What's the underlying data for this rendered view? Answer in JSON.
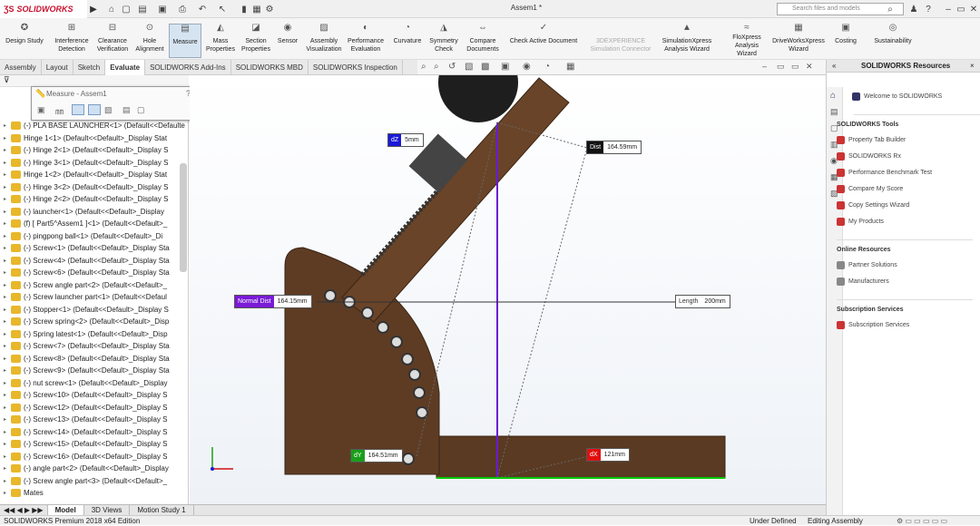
{
  "app": {
    "brand": "SOLIDWORKS",
    "doc_title": "Assem1 *",
    "search_placeholder": "Search files and models"
  },
  "commands": [
    {
      "l1": "Design Study",
      "l2": "",
      "icon": "design-study-icon"
    },
    {
      "l1": "Interference",
      "l2": "Detection",
      "icon": "interference-icon"
    },
    {
      "l1": "Clearance",
      "l2": "Verification",
      "icon": "clearance-icon"
    },
    {
      "l1": "Hole",
      "l2": "Alignment",
      "icon": "hole-icon"
    },
    {
      "l1": "Measure",
      "l2": "",
      "icon": "measure-icon"
    },
    {
      "l1": "Mass",
      "l2": "Properties",
      "icon": "mass-icon"
    },
    {
      "l1": "Section",
      "l2": "Properties",
      "icon": "section-icon"
    },
    {
      "l1": "Sensor",
      "l2": "",
      "icon": "sensor-icon"
    },
    {
      "l1": "Assembly",
      "l2": "Visualization",
      "icon": "assembly-vis-icon"
    },
    {
      "l1": "Performance",
      "l2": "Evaluation",
      "icon": "performance-icon"
    },
    {
      "l1": "Curvature",
      "l2": "",
      "icon": "curvature-icon"
    },
    {
      "l1": "Symmetry",
      "l2": "Check",
      "icon": "symmetry-icon"
    },
    {
      "l1": "Compare",
      "l2": "Documents",
      "icon": "compare-icon"
    },
    {
      "l1": "Check Active Document",
      "l2": "",
      "icon": "check-icon"
    },
    {
      "l1": "3DEXPERIENCE",
      "l2": "Simulation Connector",
      "icon": ""
    },
    {
      "l1": "SimulationXpress",
      "l2": "Analysis Wizard",
      "icon": "simxpress-icon"
    },
    {
      "l1": "FloXpress",
      "l2": "Analysis Wizard",
      "icon": "floxpress-icon"
    },
    {
      "l1": "DriveWorksXpress",
      "l2": "Wizard",
      "icon": "driveworks-icon"
    },
    {
      "l1": "",
      "l2": "Costing",
      "icon": "costing-icon"
    },
    {
      "l1": "Sustainability",
      "l2": "",
      "icon": "sustainability-icon"
    }
  ],
  "tabs": [
    "Assembly",
    "Layout",
    "Sketch",
    "Evaluate",
    "SOLIDWORKS Add-Ins",
    "SOLIDWORKS MBD",
    "SOLIDWORKS Inspection"
  ],
  "measure_dialog": {
    "title": "Measure - Assem1"
  },
  "tree": [
    "(-) PLA BASE LAUNCHER<1> (Default<<Defaulte",
    "Hinge 1<1> (Default<<Default>_Display Stat",
    "(-) Hinge 2<1> (Default<<Default>_Display S",
    "(-) Hinge 3<1> (Default<<Default>_Display S",
    "Hinge 1<2> (Default<<Default>_Display Stat",
    "(-) Hinge 3<2> (Default<<Default>_Display S",
    "(-) Hinge 2<2> (Default<<Default>_Display S",
    "(-) launcher<1> (Default<<Default>_Display",
    "(f) [ Part5^Assem1 ]<1> (Default<<Default>_",
    "(-) pingpong ball<1> (Default<<Default>_Di",
    "(-) Screw<1> (Default<<Default>_Display Sta",
    "(-) Screw<4> (Default<<Default>_Display Sta",
    "(-) Screw<6> (Default<<Default>_Display Sta",
    "(-) Screw angle part<2> (Default<<Default>_",
    "(-) Screw launcher part<1> (Default<<Defaul",
    "(-) Stopper<1> (Default<<Default>_Display S",
    "(-) Screw spring<2> (Default<<Default>_Disp",
    "(-) Spring latest<1> (Default<<Default>_Disp",
    "(-) Screw<7> (Default<<Default>_Display Sta",
    "(-) Screw<8> (Default<<Default>_Display Sta",
    "(-) Screw<9> (Default<<Default>_Display Sta",
    "(-) nut screw<1> (Default<<Default>_Display",
    "(-) Screw<10> (Default<<Default>_Display S",
    "(-) Screw<12> (Default<<Default>_Display S",
    "(-) Screw<13> (Default<<Default>_Display S",
    "(-) Screw<14> (Default<<Default>_Display S",
    "(-) Screw<15> (Default<<Default>_Display S",
    "(-) Screw<16> (Default<<Default>_Display S",
    "(-) angle part<2> (Default<<Default>_Display",
    "(-) Screw angle part<3> (Default<<Default>_",
    "Mates"
  ],
  "measurements": {
    "dz": {
      "key": "dZ",
      "value": "5mm"
    },
    "dist1": {
      "key": "Dist",
      "value": "164.59mm"
    },
    "normal": {
      "key": "Normal Dist",
      "value": "164.15mm"
    },
    "length": {
      "key": "Length",
      "value": "200mm"
    },
    "dy": {
      "key": "dY",
      "value": "164.51mm"
    },
    "dx": {
      "key": "dX",
      "value": "121mm"
    }
  },
  "bottom_tabs": [
    "Model",
    "3D Views",
    "Motion Study 1"
  ],
  "status": {
    "left": "SOLIDWORKS Premium 2018 x64 Edition",
    "under": "Under Defined",
    "editing": "Editing Assembly"
  },
  "resources": {
    "header": "SOLIDWORKS Resources",
    "welcome": "Welcome to SOLIDWORKS",
    "tools_title": "SOLIDWORKS Tools",
    "tools": [
      "Property Tab Builder",
      "SOLIDWORKS Rx",
      "Performance Benchmark Test",
      "Compare My Score",
      "Copy Settings Wizard",
      "My Products"
    ],
    "online_title": "Online Resources",
    "online": [
      "Partner Solutions",
      "Manufacturers"
    ],
    "subs_title": "Subscription Services",
    "subs": [
      "Subscription Services"
    ]
  },
  "colors": {
    "dz": "#1a1ad8",
    "dist": "#111111",
    "normal": "#7a1ad6",
    "length": "#ffffff",
    "dy": "#1a9e1a",
    "dx": "#e01010",
    "wood": "#5a3a22"
  }
}
